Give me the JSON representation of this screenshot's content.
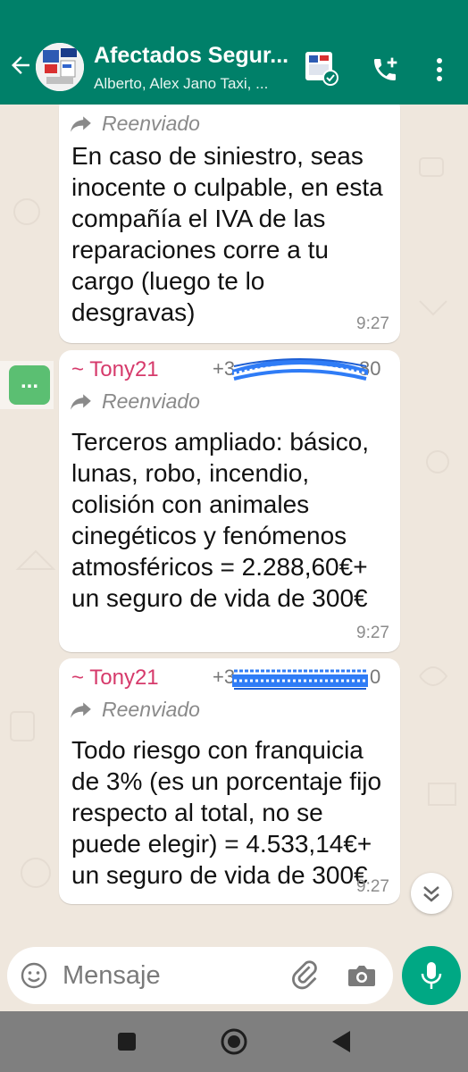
{
  "header": {
    "title": "Afectados Segur...",
    "subtitle": "Alberto, Alex Jano Taxi, ...",
    "color": "#008069"
  },
  "messages": [
    {
      "forwarded_label": "Reenviado",
      "text": "En caso de siniestro, seas inocente o culpable, en esta compañía el IVA de las reparaciones corre a tu cargo (luego te lo desgravas)",
      "time": "9:27"
    },
    {
      "sender": "~ Tony21",
      "phone_prefix": "+3",
      "phone_suffix": "80",
      "forwarded_label": "Reenviado",
      "text": "Terceros ampliado: básico, lunas, robo, incendio, colisión con animales cinegéticos y fenómenos atmosféricos = 2.288,60€+ un seguro de vida de 300€",
      "time": "9:27"
    },
    {
      "sender": "~ Tony21",
      "phone_prefix": "+3",
      "phone_suffix": "0",
      "forwarded_label": "Reenviado",
      "text": "Todo riesgo con franquicia de 3% (es un porcentaje fijo respecto al total, no se puede elegir) = 4.533,14€+ un seguro de vida de 300€",
      "time": "9:27"
    }
  ],
  "side_tag": "...",
  "input": {
    "placeholder": "Mensaje"
  },
  "icons": [
    "back-arrow-icon",
    "group-avatar",
    "call-add-icon",
    "more-vert-icon",
    "forward-icon",
    "emoji-icon",
    "attach-icon",
    "camera-icon",
    "mic-icon",
    "scroll-down-icon"
  ],
  "colors": {
    "accent": "#00a884",
    "sender": "#d63a6b",
    "chat_bg": "#efe7dd"
  }
}
